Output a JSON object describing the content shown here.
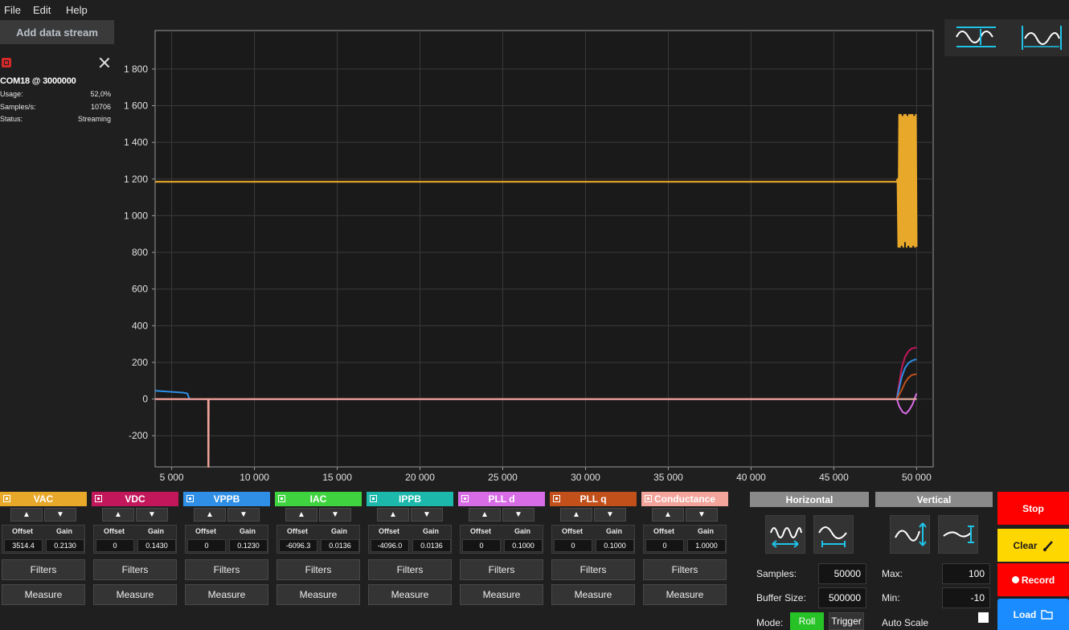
{
  "menu": [
    "File",
    "Edit",
    "Help"
  ],
  "add_stream_label": "Add data stream",
  "stream": {
    "name": "COM18 @ 3000000",
    "stats": [
      {
        "label": "Usage:",
        "value": "52,0%"
      },
      {
        "label": "Samples/s:",
        "value": "10706"
      },
      {
        "label": "Status:",
        "value": "Streaming"
      }
    ]
  },
  "plot": {
    "x_ticks": [
      "5 000",
      "10 000",
      "15 000",
      "20 000",
      "25 000",
      "30 000",
      "35 000",
      "40 000",
      "45 000",
      "50 000"
    ],
    "y_ticks": [
      "1 800",
      "1 600",
      "1 400",
      "1 200",
      "1 000",
      "800",
      "600",
      "400",
      "200",
      "0",
      "-200"
    ]
  },
  "chart_data": {
    "type": "line",
    "x_range": [
      4000,
      51000
    ],
    "y_range": [
      -370,
      2010
    ],
    "x_ticks": [
      5000,
      10000,
      15000,
      20000,
      25000,
      30000,
      35000,
      40000,
      45000,
      50000
    ],
    "y_ticks": [
      1800,
      1600,
      1400,
      1200,
      1000,
      800,
      600,
      400,
      200,
      0,
      -200
    ],
    "grid": true,
    "series": [
      {
        "name": "VAC",
        "color": "#e8a82a",
        "points": [
          [
            4000,
            1185
          ],
          [
            48800,
            1185
          ],
          [
            48850,
            1200
          ],
          [
            48900,
            830
          ],
          [
            48950,
            1550
          ],
          [
            49000,
            830
          ],
          [
            49050,
            1550
          ],
          [
            49100,
            840
          ],
          [
            49150,
            1540
          ],
          [
            49200,
            830
          ],
          [
            49250,
            1550
          ],
          [
            49300,
            860
          ],
          [
            49350,
            1550
          ],
          [
            49400,
            830
          ],
          [
            49450,
            1540
          ],
          [
            49500,
            840
          ],
          [
            49550,
            1550
          ],
          [
            49600,
            830
          ],
          [
            49650,
            1550
          ],
          [
            49700,
            830
          ],
          [
            49750,
            1550
          ],
          [
            49800,
            840
          ],
          [
            49850,
            1540
          ],
          [
            49900,
            830
          ],
          [
            49950,
            1550
          ],
          [
            50000,
            830
          ]
        ]
      },
      {
        "name": "VDC",
        "color": "#c2185b",
        "points": [
          [
            4000,
            0
          ],
          [
            48800,
            0
          ],
          [
            48900,
            60
          ],
          [
            49100,
            170
          ],
          [
            49300,
            230
          ],
          [
            49500,
            260
          ],
          [
            49700,
            275
          ],
          [
            49900,
            280
          ],
          [
            50000,
            280
          ]
        ]
      },
      {
        "name": "VPPB",
        "color": "#2f8fe6",
        "points": [
          [
            4000,
            45
          ],
          [
            5700,
            35
          ],
          [
            5950,
            30
          ],
          [
            6050,
            5
          ],
          [
            6100,
            0
          ],
          [
            48800,
            0
          ],
          [
            48900,
            40
          ],
          [
            49100,
            120
          ],
          [
            49300,
            170
          ],
          [
            49500,
            195
          ],
          [
            49700,
            208
          ],
          [
            49900,
            215
          ],
          [
            50000,
            215
          ]
        ]
      },
      {
        "name": "IAC",
        "color": "#3fd43f",
        "points": [
          [
            4000,
            0
          ],
          [
            50000,
            0
          ]
        ]
      },
      {
        "name": "IPPB",
        "color": "#1bb8ab",
        "points": [
          [
            4000,
            0
          ],
          [
            50000,
            0
          ]
        ]
      },
      {
        "name": "PLL d",
        "color": "#d86ce6",
        "points": [
          [
            4000,
            0
          ],
          [
            48800,
            0
          ],
          [
            48950,
            -40
          ],
          [
            49150,
            -70
          ],
          [
            49350,
            -80
          ],
          [
            49550,
            -60
          ],
          [
            49750,
            -30
          ],
          [
            49950,
            20
          ],
          [
            50000,
            30
          ]
        ]
      },
      {
        "name": "PLL q",
        "color": "#c1501a",
        "points": [
          [
            4000,
            0
          ],
          [
            48800,
            0
          ],
          [
            48900,
            15
          ],
          [
            49100,
            50
          ],
          [
            49300,
            90
          ],
          [
            49500,
            115
          ],
          [
            49700,
            130
          ],
          [
            49900,
            135
          ],
          [
            50000,
            135
          ]
        ]
      },
      {
        "name": "Conductance",
        "color": "#f3a49b",
        "points": [
          [
            4000,
            0
          ],
          [
            7200,
            0
          ],
          [
            7210,
            -370
          ],
          [
            7230,
            -370
          ],
          [
            7240,
            0
          ],
          [
            50000,
            0
          ]
        ]
      }
    ]
  },
  "channels": [
    {
      "label": "VAC",
      "color": "#e8a82a",
      "offset": "3514.4",
      "gain": "0.2130"
    },
    {
      "label": "VDC",
      "color": "#c2185b",
      "offset": "0",
      "gain": "0.1430"
    },
    {
      "label": "VPPB",
      "color": "#2f8fe6",
      "offset": "0",
      "gain": "0.1230"
    },
    {
      "label": "IAC",
      "color": "#3fd43f",
      "offset": "-6096.3",
      "gain": "0.0136"
    },
    {
      "label": "IPPB",
      "color": "#1bb8ab",
      "offset": "-4096.0",
      "gain": "0.0136"
    },
    {
      "label": "PLL d",
      "color": "#d86ce6",
      "offset": "0",
      "gain": "0.1000"
    },
    {
      "label": "PLL q",
      "color": "#c1501a",
      "offset": "0",
      "gain": "0.1000"
    },
    {
      "label": "Conductance",
      "color": "#f3a49b",
      "offset": "0",
      "gain": "1.0000"
    }
  ],
  "channel_labels": {
    "offset": "Offset",
    "gain": "Gain",
    "filters": "Filters",
    "measure": "Measure",
    "up": "▲",
    "down": "▼"
  },
  "horizontal": {
    "title": "Horizontal",
    "samples_label": "Samples:",
    "samples": "50000",
    "buffer_label": "Buffer Size:",
    "buffer": "500000",
    "mode_label": "Mode:",
    "mode_roll": "Roll",
    "mode_trigger": "Trigger",
    "active_mode": "Roll"
  },
  "vertical": {
    "title": "Vertical",
    "max_label": "Max:",
    "max": "100",
    "min_label": "Min:",
    "min": "-10",
    "autoscale_label": "Auto Scale",
    "autoscale_checked": false
  },
  "actions": [
    {
      "label": "Stop",
      "color": "#ff0000",
      "text_color": "#ffffff"
    },
    {
      "label": "Clear",
      "color": "#ffd700",
      "text_color": "#1a1a1a"
    },
    {
      "label": "Record",
      "color": "#ff0000",
      "text_color": "#ffffff"
    },
    {
      "label": "Load",
      "color": "#1a8cff",
      "text_color": "#ffffff"
    }
  ],
  "colors": {
    "accent_cyan": "#1fc3e8",
    "background": "#1f1f1f",
    "plot_bg": "#1a1a1a",
    "grid": "#3a3a3a"
  }
}
